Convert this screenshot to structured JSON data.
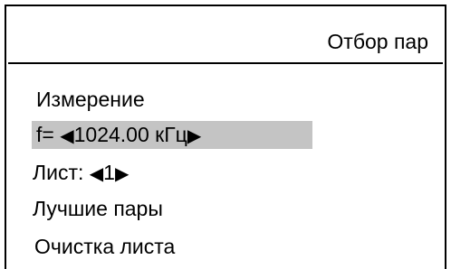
{
  "header": {
    "title": "Отбор пар"
  },
  "menu": {
    "measure_label": "Измерение",
    "frequency": {
      "prefix": "f=",
      "left_arrow": "◀",
      "value": "1024.00 кГц",
      "right_arrow": "▶"
    },
    "sheet": {
      "label": "Лист:",
      "left_arrow": "◀",
      "value": "1",
      "right_arrow": "▶"
    },
    "best_pairs_label": "Лучшие пары",
    "clear_sheet_label": "Очистка листа"
  },
  "colors": {
    "selection_highlight": "#c4c4c4",
    "foreground": "#000000",
    "background": "#ffffff"
  }
}
